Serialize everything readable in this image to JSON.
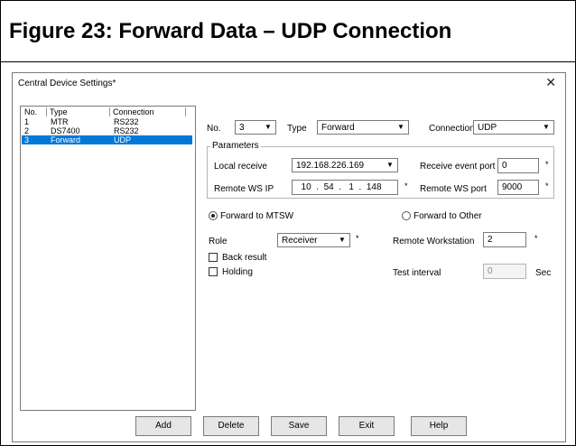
{
  "figure": {
    "title": "Figure 23:  Forward Data – UDP Connection"
  },
  "dialog": {
    "title": "Central Device Settings*",
    "close_glyph": "✕"
  },
  "device_list": {
    "columns": [
      "No.",
      "Type",
      "Connection"
    ],
    "rows": [
      {
        "no": "1",
        "type": "MTR",
        "connection": "RS232",
        "selected": false
      },
      {
        "no": "2",
        "type": "DS7400",
        "connection": "RS232",
        "selected": false
      },
      {
        "no": "3",
        "type": "Forward",
        "connection": "UDP",
        "selected": true
      }
    ]
  },
  "top_row": {
    "no_label": "No.",
    "no_value": "3",
    "type_label": "Type",
    "type_value": "Forward",
    "connection_label": "Connection",
    "connection_value": "UDP"
  },
  "parameters": {
    "group_label": "Parameters",
    "local_receive_label": "Local receive",
    "local_receive_value": "192.168.226.169",
    "receive_event_port_label": "Receive event port",
    "receive_event_port_value": "0",
    "remote_ws_ip_label": "Remote WS IP",
    "remote_ws_ip_value": "  10  .  54  .   1  .  148",
    "remote_ws_port_label": "Remote WS port",
    "remote_ws_port_value": "9000",
    "required_mark": "*"
  },
  "forward": {
    "mtsw_label": "Forward to MTSW",
    "other_label": "Forward to Other",
    "selected": "mtsw"
  },
  "role": {
    "role_label": "Role",
    "role_value": "Receiver",
    "remote_workstation_label": "Remote Workstation",
    "remote_workstation_value": "2",
    "required_mark": "*"
  },
  "options": {
    "back_result_label": "Back result",
    "back_result_checked": false,
    "holding_label": "Holding",
    "holding_checked": false,
    "test_interval_label": "Test interval",
    "test_interval_value": "0",
    "unit_label": "Sec"
  },
  "buttons": {
    "add": "Add",
    "delete": "Delete",
    "save": "Save",
    "exit": "Exit",
    "help": "Help"
  },
  "icons": {
    "dropdown": "▼"
  },
  "colors": {
    "selection": "#0078d7"
  }
}
